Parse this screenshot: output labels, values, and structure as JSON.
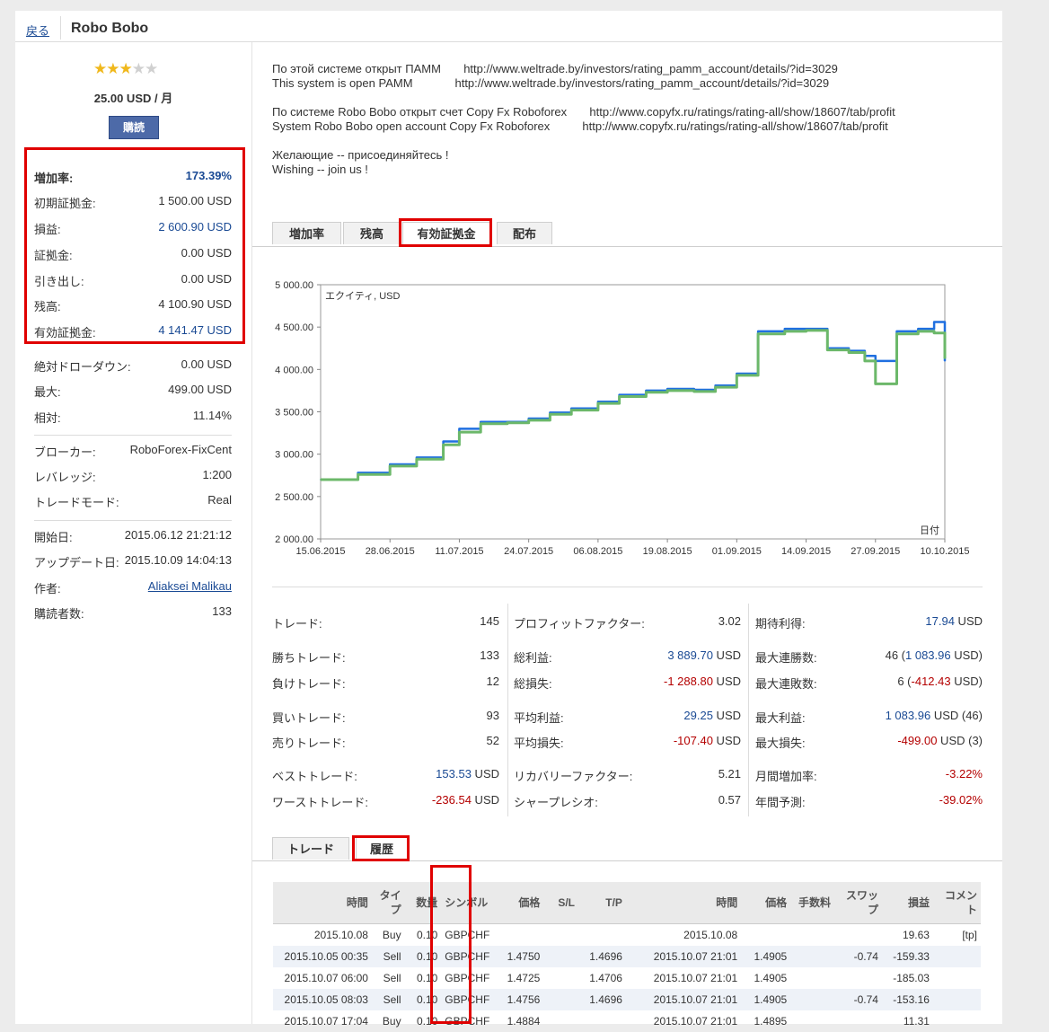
{
  "header": {
    "back_label": "戻る",
    "title": "Robo Bobo"
  },
  "sidebar": {
    "rating_stars": 3,
    "rating_max": 5,
    "price": "25.00 USD / 月",
    "subscribe_label": "購読",
    "summary": [
      {
        "label": "増加率:",
        "value": "173.39%"
      },
      {
        "label": "初期証拠金:",
        "value": "1 500.00 USD"
      },
      {
        "label": "損益:",
        "value": "2 600.90 USD"
      },
      {
        "label": "証拠金:",
        "value": "0.00 USD"
      },
      {
        "label": "引き出し:",
        "value": "0.00 USD"
      },
      {
        "label": "残高:",
        "value": "4 100.90 USD"
      },
      {
        "label": "有効証拠金:",
        "value": "4 141.47 USD"
      }
    ],
    "drawdown": [
      {
        "label": "絶対ドローダウン:",
        "value": "0.00 USD"
      },
      {
        "label": "最大:",
        "value": "499.00 USD"
      },
      {
        "label": "相対:",
        "value": "11.14%"
      }
    ],
    "account": [
      {
        "label": "ブローカー:",
        "value": "RoboForex-FixCent"
      },
      {
        "label": "レバレッジ:",
        "value": "1:200"
      },
      {
        "label": "トレードモード:",
        "value": "Real"
      }
    ],
    "meta": [
      {
        "label": "開始日:",
        "value": "2015.06.12 21:21:12"
      },
      {
        "label": "アップデート日:",
        "value": "2015.10.09 14:04:13"
      },
      {
        "label": "作者:",
        "value": "Aliaksei Malikau"
      },
      {
        "label": "購読者数:",
        "value": "133"
      }
    ]
  },
  "description": {
    "lines": [
      "По этой системе открыт ПАММ       http://www.weltrade.by/investors/rating_pamm_account/details/?id=3029",
      "This system is open PAMM             http://www.weltrade.by/investors/rating_pamm_account/details/?id=3029",
      "По системе Robo Bobo открыт счет Copy Fx Roboforex       http://www.copyfx.ru/ratings/rating-all/show/18607/tab/profit",
      "System Robo Bobo open account Copy Fx Roboforex          http://www.copyfx.ru/ratings/rating-all/show/18607/tab/profit",
      "Желающие -- присоединяйтесь !",
      "Wishing -- join us !"
    ]
  },
  "chart_tabs": [
    "増加率",
    "残高",
    "有効証拠金",
    "配布"
  ],
  "chart_data": {
    "type": "line",
    "title": "エクイティ, USD",
    "xlabel": "日付",
    "ylabel": "",
    "x_ticks": [
      "15.06.2015",
      "28.06.2015",
      "11.07.2015",
      "24.07.2015",
      "06.08.2015",
      "19.08.2015",
      "01.09.2015",
      "14.09.2015",
      "27.09.2015",
      "10.10.2015"
    ],
    "y_ticks": [
      "5 000.00",
      "4 500.00",
      "4 000.00",
      "3 500.00",
      "3 000.00",
      "2 500.00",
      "2 000.00"
    ],
    "ylim": [
      2000,
      5000
    ],
    "grid": false,
    "series": [
      {
        "color": "#1f6fe0",
        "x": [
          "2015-06-15",
          "2015-06-22",
          "2015-06-28",
          "2015-07-03",
          "2015-07-08",
          "2015-07-11",
          "2015-07-15",
          "2015-07-20",
          "2015-07-24",
          "2015-07-28",
          "2015-08-01",
          "2015-08-06",
          "2015-08-10",
          "2015-08-15",
          "2015-08-19",
          "2015-08-24",
          "2015-08-28",
          "2015-09-01",
          "2015-09-05",
          "2015-09-10",
          "2015-09-14",
          "2015-09-18",
          "2015-09-22",
          "2015-09-25",
          "2015-09-27",
          "2015-10-01",
          "2015-10-05",
          "2015-10-08",
          "2015-10-10"
        ],
        "y": [
          2700,
          2780,
          2880,
          2960,
          3150,
          3300,
          3380,
          3380,
          3420,
          3490,
          3540,
          3620,
          3700,
          3750,
          3770,
          3760,
          3810,
          3950,
          4450,
          4480,
          4480,
          4250,
          4220,
          4160,
          4100,
          4450,
          4480,
          4560,
          4100
        ]
      },
      {
        "color": "#6cb86a",
        "x": [
          "2015-06-15",
          "2015-06-22",
          "2015-06-28",
          "2015-07-03",
          "2015-07-08",
          "2015-07-11",
          "2015-07-15",
          "2015-07-20",
          "2015-07-24",
          "2015-07-28",
          "2015-08-01",
          "2015-08-06",
          "2015-08-10",
          "2015-08-15",
          "2015-08-19",
          "2015-08-24",
          "2015-08-28",
          "2015-09-01",
          "2015-09-05",
          "2015-09-10",
          "2015-09-14",
          "2015-09-18",
          "2015-09-22",
          "2015-09-25",
          "2015-09-27",
          "2015-10-01",
          "2015-10-05",
          "2015-10-08",
          "2015-10-10"
        ],
        "y": [
          2700,
          2760,
          2860,
          2940,
          3110,
          3260,
          3360,
          3370,
          3400,
          3470,
          3520,
          3600,
          3680,
          3730,
          3750,
          3740,
          3790,
          3930,
          4420,
          4450,
          4460,
          4230,
          4200,
          4100,
          3830,
          4420,
          4450,
          4430,
          4130
        ]
      }
    ]
  },
  "stats": [
    [
      {
        "label": "トレード:",
        "value": "145"
      },
      {
        "label": "勝ちトレード:",
        "value": "133"
      },
      {
        "label": "負けトレード:",
        "value": "12"
      },
      {
        "label": "買いトレード:",
        "value": "93"
      },
      {
        "label": "売りトレード:",
        "value": "52"
      },
      {
        "label": "ベストトレード:",
        "value": "153.53",
        "unit": " USD"
      },
      {
        "label": "ワーストトレード:",
        "value": "-236.54",
        "unit": " USD"
      }
    ],
    [
      {
        "label": "プロフィットファクター:",
        "value": "3.02"
      },
      {
        "label": "総利益:",
        "value": "3 889.70",
        "unit": " USD"
      },
      {
        "label": "総損失:",
        "value": "-1 288.80",
        "unit": " USD"
      },
      {
        "label": "平均利益:",
        "value": "29.25",
        "unit": " USD"
      },
      {
        "label": "平均損失:",
        "value": "-107.40",
        "unit": " USD"
      },
      {
        "label": "リカバリーファクター:",
        "value": "5.21"
      },
      {
        "label": "シャープレシオ:",
        "value": "0.57"
      }
    ],
    [
      {
        "label": "期待利得:",
        "value": "17.94",
        "unit": " USD"
      },
      {
        "label": "最大連勝数:",
        "pre": "46 (",
        "value": "1 083.96",
        "unit": " USD)"
      },
      {
        "label": "最大連敗数:",
        "pre": "6 (",
        "value": "-412.43",
        "unit": " USD)"
      },
      {
        "label": "最大利益:",
        "value": "1 083.96",
        "unit": " USD (46)"
      },
      {
        "label": "最大損失:",
        "value": "-499.00",
        "unit": " USD (3)"
      },
      {
        "label": "月間増加率:",
        "value": "-3.22%"
      },
      {
        "label": "年間予測:",
        "value": "-39.02%"
      }
    ]
  ],
  "history_tabs": [
    "トレード",
    "履歴"
  ],
  "history": {
    "headers": [
      "時間",
      "タイプ",
      "数量",
      "シンボル",
      "価格",
      "S/L",
      "T/P",
      "時間",
      "価格",
      "手数料",
      "スワップ",
      "損益",
      "コメント"
    ],
    "rows": [
      [
        "2015.10.08",
        "Buy",
        "0.10",
        "GBPCHF",
        "",
        "",
        "",
        "2015.10.08",
        "",
        "",
        "",
        "19.63",
        "[tp]"
      ],
      [
        "2015.10.05 00:35",
        "Sell",
        "0.10",
        "GBPCHF",
        "1.4750",
        "",
        "1.4696",
        "2015.10.07 21:01",
        "1.4905",
        "",
        "-0.74",
        "-159.33",
        ""
      ],
      [
        "2015.10.07 06:00",
        "Sell",
        "0.10",
        "GBPCHF",
        "1.4725",
        "",
        "1.4706",
        "2015.10.07 21:01",
        "1.4905",
        "",
        "",
        "-185.03",
        ""
      ],
      [
        "2015.10.05 08:03",
        "Sell",
        "0.10",
        "GBPCHF",
        "1.4756",
        "",
        "1.4696",
        "2015.10.07 21:01",
        "1.4905",
        "",
        "-0.74",
        "-153.16",
        ""
      ],
      [
        "2015.10.07 17:04",
        "Buy",
        "0.10",
        "GBPCHF",
        "1.4884",
        "",
        "",
        "2015.10.07 21:01",
        "1.4895",
        "",
        "",
        "11.31",
        ""
      ]
    ]
  }
}
